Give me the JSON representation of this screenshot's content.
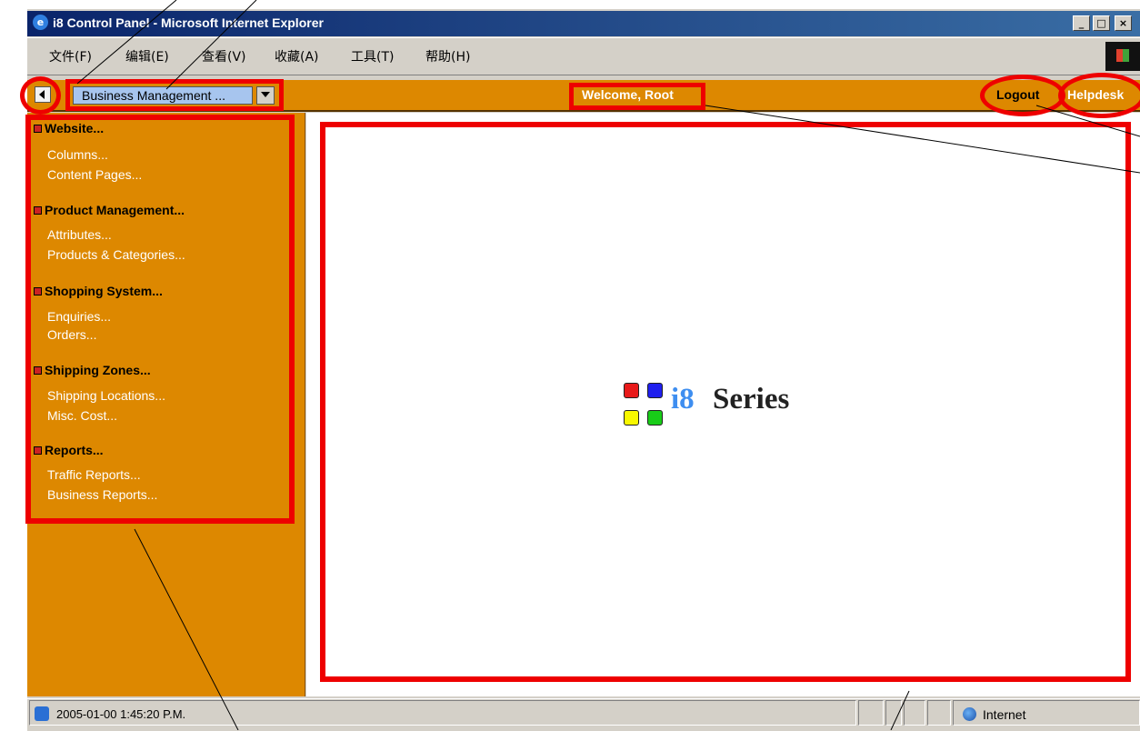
{
  "window": {
    "title": "i8 Control Panel - Microsoft Internet Explorer",
    "caption_buttons": [
      "_",
      "□",
      "×"
    ]
  },
  "menubar": {
    "items": [
      "文件(F)",
      "编辑(E)",
      "查看(V)",
      "收藏(A)",
      "工具(T)",
      "帮助(H)"
    ]
  },
  "appbar": {
    "section_select": "Business Management ...",
    "welcome": "Welcome, Root",
    "logout": "Logout",
    "helpdesk": "Helpdesk"
  },
  "sidebar": {
    "sections": [
      {
        "title": "Website...",
        "links": [
          "Columns...",
          "Content Pages..."
        ]
      },
      {
        "title": "Product Management...",
        "links": [
          "Attributes...",
          "Products & Categories..."
        ]
      },
      {
        "title": "Shopping System...",
        "links": [
          "Enquiries...",
          "Orders..."
        ]
      },
      {
        "title": "Shipping Zones...",
        "links": [
          "Shipping Locations...",
          "Misc. Cost..."
        ]
      },
      {
        "title": "Reports...",
        "links": [
          "Traffic Reports...",
          "Business Reports..."
        ]
      }
    ]
  },
  "content": {
    "logo_i8": "i8",
    "logo_series": "Series"
  },
  "statusbar": {
    "text": "2005-01-00 1:45:20 P.M.",
    "zone": "Internet"
  },
  "colors": {
    "accent_orange": "#dd8800",
    "annotation_red": "#ee0000",
    "titlebar_blue": "#0a246a"
  }
}
